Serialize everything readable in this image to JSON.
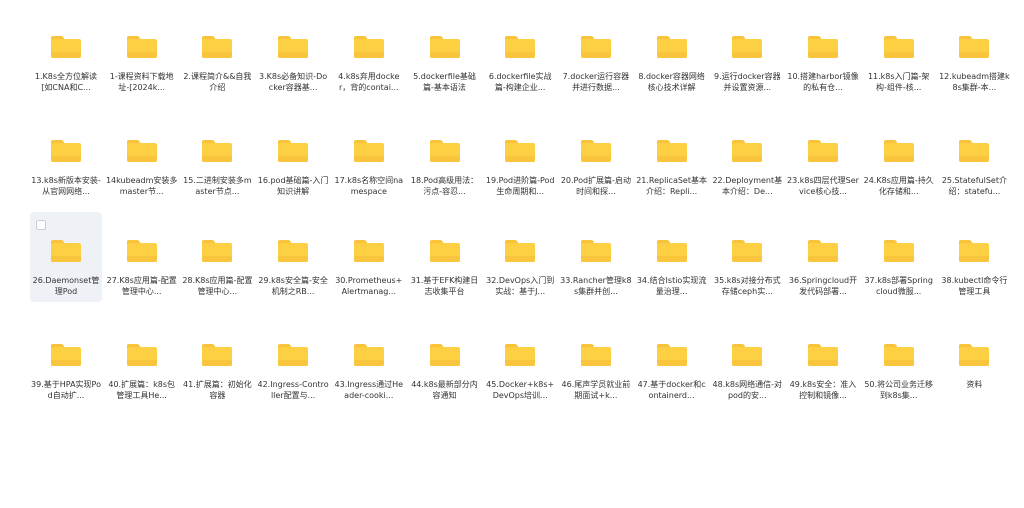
{
  "folders": [
    "1.K8s全方位解读[如CNA和C...",
    "1-课程资料下载地址-[2024k...",
    "2.课程简介&&自我介绍",
    "3.K8s必备知识-Docker容器基...",
    "4.k8s弃用docker，背的contai...",
    "5.dockerfile基础篇-基本语法",
    "6.dockerfile实战篇-构建企业...",
    "7.docker运行容器并进行数据...",
    "8.docker容器网络核心技术详解",
    "9.运行docker容器并设置资源...",
    "10.搭建harbor镜像的私有仓...",
    "11.k8s入门篇-架构-组件-核...",
    "12.kubeadm搭建k8s集群-本...",
    "13.k8s新版本安装-从官网网络...",
    "14kubeadm安装多master节...",
    "15.二进制安装多master节点...",
    "16.pod基础篇-入门知识讲解",
    "17.k8s名称空间namespace",
    "18.Pod高级用法：污点-容忍...",
    "19.Pod进阶篇-Pod生命周期和...",
    "20.Pod扩展篇-启动时间和探...",
    "21.ReplicaSet基本介绍：Repli...",
    "22.Deployment基本介绍：De...",
    "23.k8s四层代理Service核心技...",
    "24.K8s应用篇-持久化存储和...",
    "25.StatefulSet介绍：statefu...",
    "26.Daemonset管理Pod",
    "27.K8s应用篇-配置管理中心...",
    "28.K8s应用篇-配置管理中心...",
    "29.k8s安全篇-安全机制之RB...",
    "30.Prometheus+Alertmanag...",
    "31.基于EFK构建日志收集平台",
    "32.DevOps入门到实战：基于J...",
    "33.Rancher管理k8s集群并创...",
    "34.结合Istio实现流量治理...",
    "35.k8s对接分布式存储ceph实...",
    "36.Springcloud开发代码部署...",
    "37.k8s部署Springcloud微服...",
    "38.kubectl命令行管理工具",
    "39.基于HPA实现Pod自动扩...",
    "40.扩展篇：k8s包管理工具He...",
    "41.扩展篇：初始化容器",
    "42.Ingress-Controller配置与...",
    "43.Ingress通过Header-cooki...",
    "44.k8s最新部分内容通知",
    "45.Docker+k8s+DevOps培训...",
    "46.尾声学员就业前期面试+k...",
    "47.基于docker和containerd...",
    "48.k8s网络通信-对pod的安...",
    "49.k8s安全：准入控制和镜像...",
    "50.将公司业务迁移到k8s集...",
    "资料"
  ],
  "selected_index": 26,
  "colors": {
    "folder": "#fdcf42",
    "folder_tab": "#f8c23a",
    "selected_bg": "#eef2f7",
    "text": "#333333"
  }
}
